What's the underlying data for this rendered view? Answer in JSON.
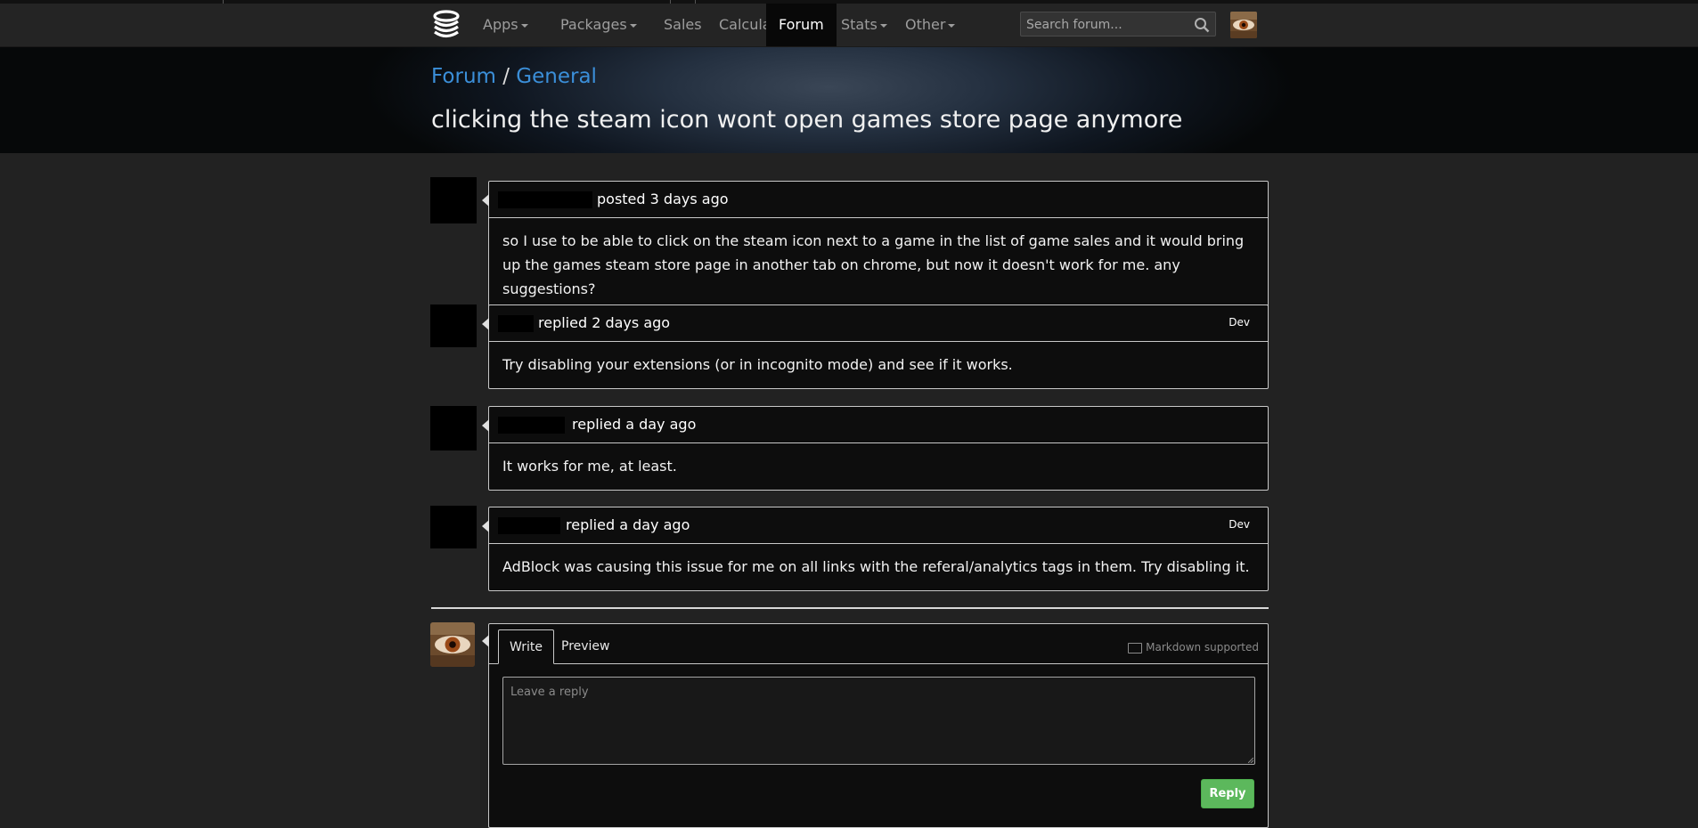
{
  "nav": {
    "items": [
      {
        "label": "Apps"
      },
      {
        "label": "Packages"
      },
      {
        "label": "Sales"
      },
      {
        "label": "Calculator"
      },
      {
        "label": "Forum"
      },
      {
        "label": "Stats"
      },
      {
        "label": "Other"
      }
    ],
    "active": "Forum",
    "search_placeholder": "Search forum...",
    "search_value": ""
  },
  "breadcrumb": {
    "root": "Forum",
    "separator": "/",
    "category": "General"
  },
  "thread": {
    "title": "clicking the steam icon wont open games store page anymore"
  },
  "posts": [
    {
      "meta": "posted 3 days ago",
      "badge": "",
      "body": "so I use to be able to click on the steam icon next to a game in the list of game sales and it would bring up the games steam store page in another tab on chrome, but now it doesn't work for me. any suggestions?"
    },
    {
      "meta": "replied 2 days ago",
      "badge": "Dev",
      "body": "Try disabling your extensions (or in incognito mode) and see if it works."
    },
    {
      "meta": "replied a day ago",
      "badge": "",
      "body": "It works for me, at least."
    },
    {
      "meta": "replied a day ago",
      "badge": "Dev",
      "body": "AdBlock was causing this issue for me on all links with the referal/analytics tags in them. Try disabling it."
    }
  ],
  "reply": {
    "tab_write": "Write",
    "tab_preview": "Preview",
    "markdown_note": "Markdown supported",
    "placeholder": "Leave a reply",
    "value": "",
    "submit_label": "Reply"
  },
  "colors": {
    "link": "#3b8fd9",
    "reply_button": "#5cb85c",
    "navbar": "#242424",
    "page_bg": "#222222"
  },
  "icons": {
    "logo": "coin-stack-icon",
    "search": "search-icon",
    "markdown": "markdown-icon"
  }
}
